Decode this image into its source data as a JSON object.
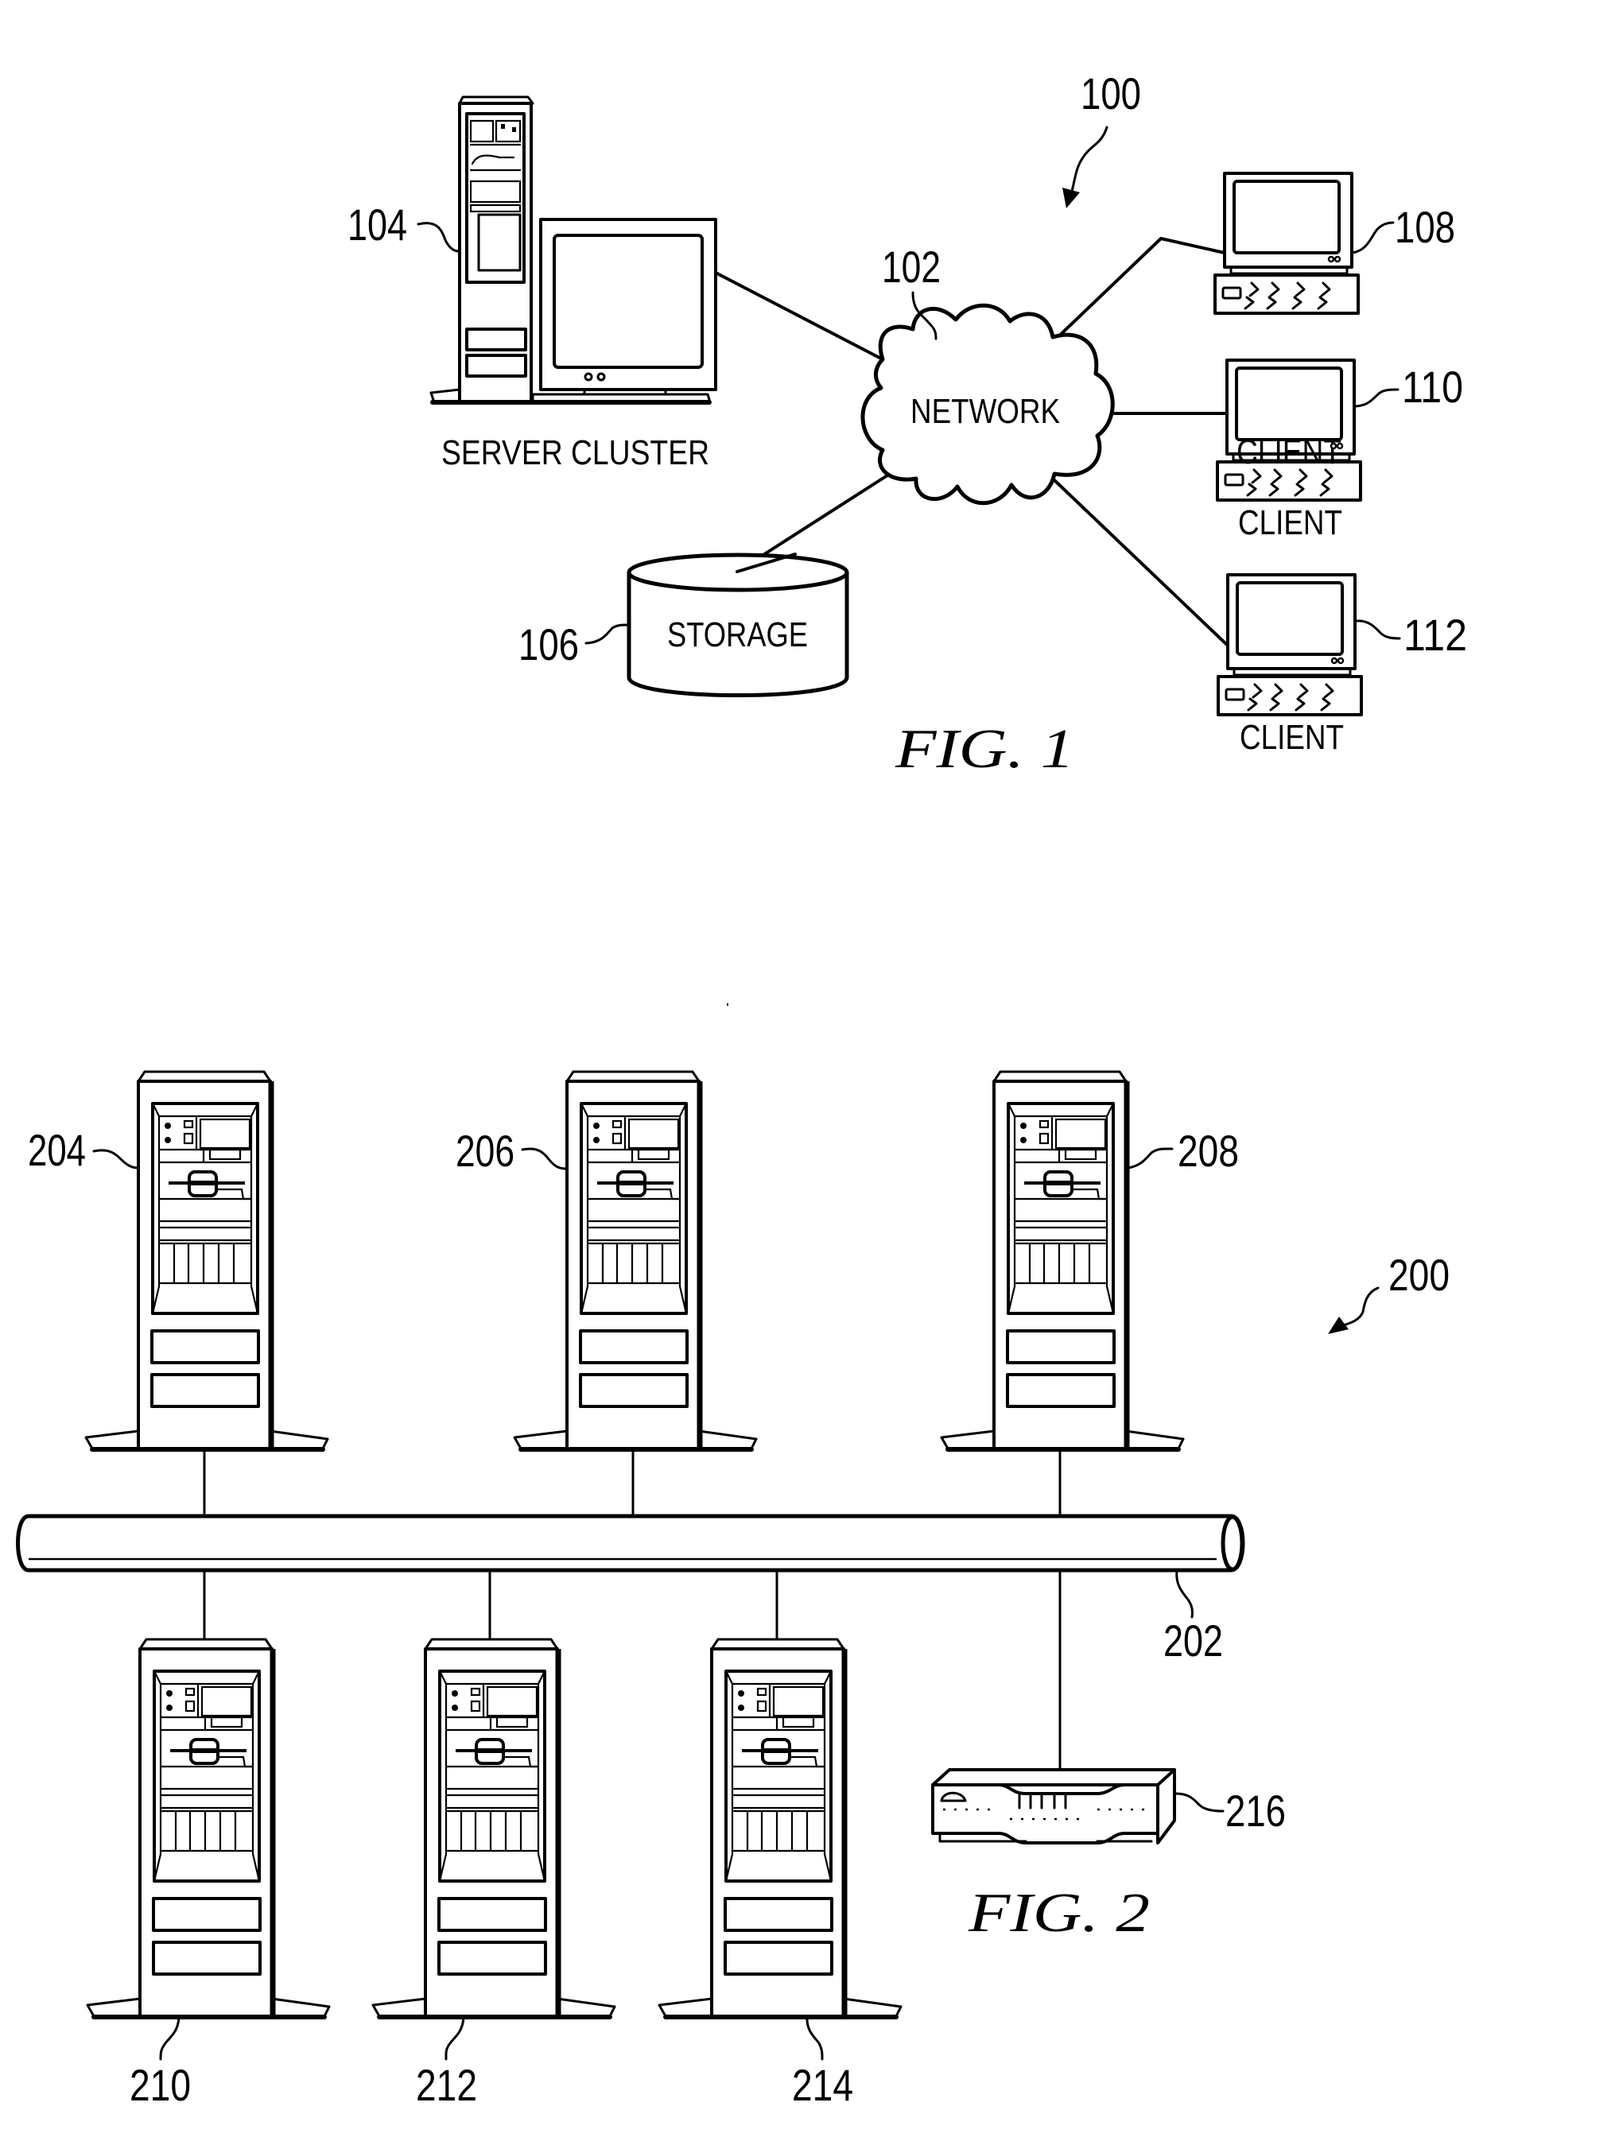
{
  "figure_1": {
    "caption": "FIG. 1",
    "system_ref": "100",
    "network": {
      "ref": "102",
      "label": "NETWORK"
    },
    "server_cluster": {
      "ref": "104",
      "label": "SERVER CLUSTER"
    },
    "storage": {
      "ref": "106",
      "label": "STORAGE"
    },
    "clients": [
      {
        "ref": "108",
        "label": "CLIENT"
      },
      {
        "ref": "110",
        "label": "CLIENT"
      },
      {
        "ref": "112",
        "label": "CLIENT"
      }
    ]
  },
  "figure_2": {
    "caption": "FIG. 2",
    "system_ref": "200",
    "bus_ref": "202",
    "servers": [
      {
        "ref": "204"
      },
      {
        "ref": "206"
      },
      {
        "ref": "208"
      },
      {
        "ref": "210"
      },
      {
        "ref": "212"
      },
      {
        "ref": "214"
      }
    ],
    "network_device_ref": "216"
  },
  "icons": {
    "server": "server-tower-icon",
    "client": "client-workstation-icon",
    "network": "cloud-icon",
    "storage": "database-cylinder-icon",
    "bus": "network-bus-pipe-icon",
    "router": "router-hub-icon"
  }
}
